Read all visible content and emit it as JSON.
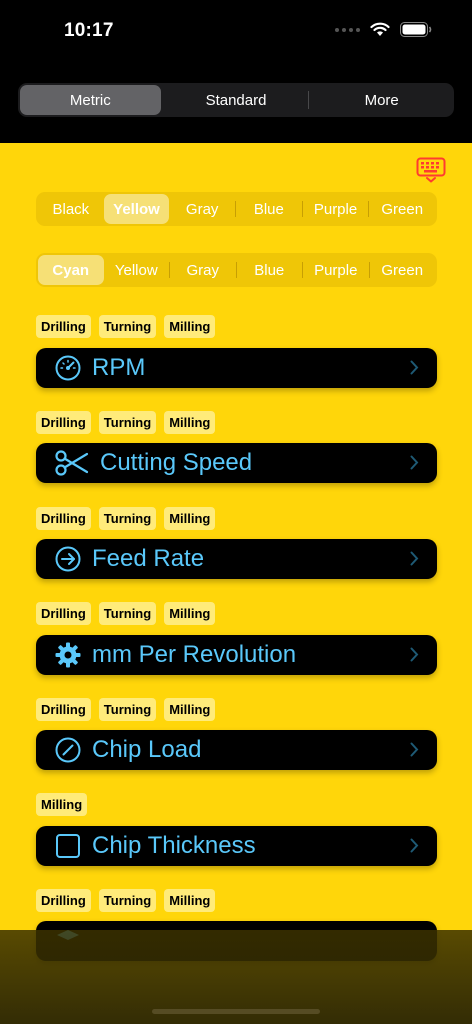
{
  "status_bar": {
    "time": "10:17"
  },
  "units_tabs": {
    "items": [
      "Metric",
      "Standard",
      "More"
    ],
    "selected": 0
  },
  "theme_colors": {
    "items": [
      "Black",
      "Yellow",
      "Gray",
      "Blue",
      "Purple",
      "Green"
    ],
    "selected": 1
  },
  "accent_colors": {
    "items": [
      "Cyan",
      "Yellow",
      "Gray",
      "Blue",
      "Purple",
      "Green"
    ],
    "selected": 0
  },
  "colors": {
    "background": "#FFD60A",
    "row_background": "#000000",
    "accent": "#5AC8FA",
    "tag_background": "#FFEB7A"
  },
  "calculators": [
    {
      "tags": [
        "Drilling",
        "Turning",
        "Milling"
      ],
      "label": "RPM",
      "icon": "gauge-icon"
    },
    {
      "tags": [
        "Drilling",
        "Turning",
        "Milling"
      ],
      "label": "Cutting Speed",
      "icon": "scissors-icon"
    },
    {
      "tags": [
        "Drilling",
        "Turning",
        "Milling"
      ],
      "label": "Feed Rate",
      "icon": "arrow-circle-icon"
    },
    {
      "tags": [
        "Drilling",
        "Turning",
        "Milling"
      ],
      "label": "mm Per Revolution",
      "icon": "gear-icon"
    },
    {
      "tags": [
        "Drilling",
        "Turning",
        "Milling"
      ],
      "label": "Chip Load",
      "icon": "slash-circle-icon"
    },
    {
      "tags": [
        "Milling"
      ],
      "label": "Chip Thickness",
      "icon": "square-icon"
    },
    {
      "tags": [
        "Drilling",
        "Turning",
        "Milling"
      ],
      "label": "",
      "icon": "cube-icon"
    }
  ]
}
